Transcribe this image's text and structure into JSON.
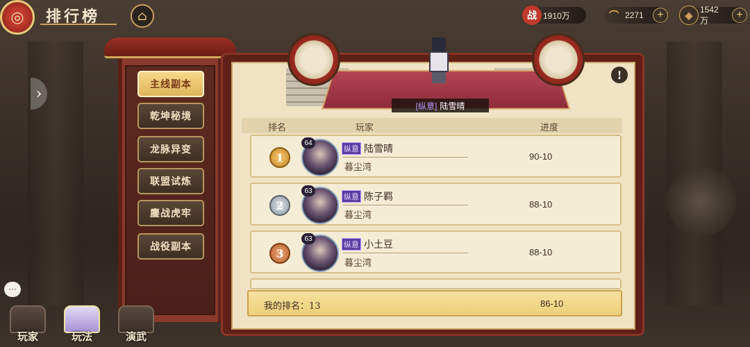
{
  "header": {
    "title": "排行榜",
    "logo_icon": "swirl-emblem-icon",
    "home_icon": "home-icon"
  },
  "resources": [
    {
      "icon_label": "战",
      "value": "1910万",
      "color": "#c0392b",
      "has_plus": false
    },
    {
      "icon_label": "⌒",
      "value": "2271",
      "color": "#e8b84a",
      "has_plus": true
    },
    {
      "icon_label": "◈",
      "value": "1542万",
      "color": "#d4a75a",
      "has_plus": true
    }
  ],
  "menu": {
    "items": [
      "主线副本",
      "乾坤秘境",
      "龙脉异变",
      "联盟试炼",
      "鏖战虎牢",
      "战役副本"
    ],
    "active_index": 0
  },
  "stage": {
    "champion_tag": "[纵意]",
    "champion_name": "陆雪晴"
  },
  "table": {
    "headers": {
      "rank": "排名",
      "player": "玩家",
      "progress": "进度"
    },
    "rows": [
      {
        "rank": "1",
        "level": "64",
        "tag": "纵意",
        "name": "陆雪晴",
        "server": "暮尘湾",
        "progress": "90-10"
      },
      {
        "rank": "2",
        "level": "63",
        "tag": "纵意",
        "name": "陈子羁",
        "server": "暮尘湾",
        "progress": "88-10"
      },
      {
        "rank": "3",
        "level": "63",
        "tag": "纵意",
        "name": "小土豆",
        "server": "暮尘湾",
        "progress": "88-10"
      }
    ]
  },
  "my_rank": {
    "label": "我的排名：13",
    "progress": "86-10"
  },
  "bottom_nav": {
    "items": [
      "玩家",
      "玩法",
      "演武"
    ],
    "active_index": 1
  },
  "chat_icon": "chat-bubble-icon"
}
